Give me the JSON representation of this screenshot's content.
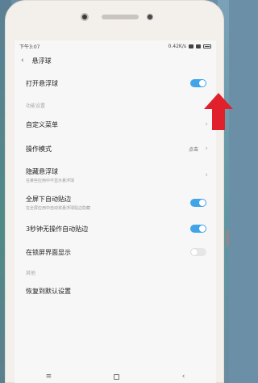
{
  "status": {
    "time": "下午3:07",
    "speed": "0.42K/s"
  },
  "title": "悬浮球",
  "items": {
    "open_float": "打开悬浮球",
    "section_function": "功能设置",
    "custom_menu": "自定义菜单",
    "operation_mode": "操作模式",
    "operation_mode_value": "点击",
    "hide_float": "隐藏悬浮球",
    "hide_float_sub": "在某些应用中不显示悬浮球",
    "fullscreen_snap": "全屏下自动贴边",
    "fullscreen_snap_sub": "在全屏应用中自动将悬浮球贴边隐藏",
    "auto_snap_3s": "3秒钟无操作自动贴边",
    "lockscreen_show": "在锁屏界面显示",
    "section_other": "其他",
    "restore_default": "恢复到默认设置"
  },
  "toggles": {
    "open_float": true,
    "fullscreen_snap": true,
    "auto_snap_3s": true,
    "lockscreen_show": false
  },
  "colors": {
    "accent": "#3fa4ea",
    "annotation_arrow": "#e0202a"
  }
}
